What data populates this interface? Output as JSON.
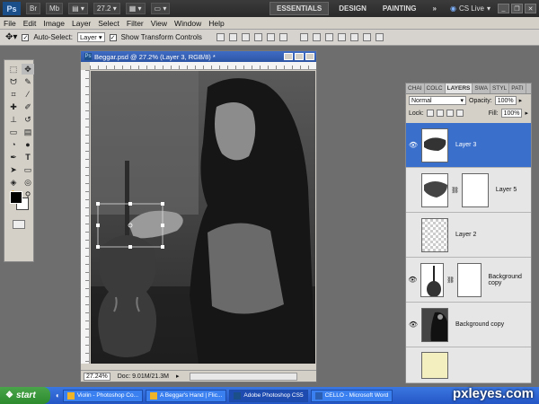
{
  "app": {
    "logo": "Ps",
    "zoom_value": "27.2",
    "workspaces": [
      "ESSENTIALS",
      "DESIGN",
      "PAINTING"
    ],
    "more": "»",
    "cs_live": "CS Live"
  },
  "menu": [
    "File",
    "Edit",
    "Image",
    "Layer",
    "Select",
    "Filter",
    "View",
    "Window",
    "Help"
  ],
  "options": {
    "auto_select_label": "Auto-Select:",
    "auto_select_value": "Layer",
    "show_transform_label": "Show Transform Controls"
  },
  "document": {
    "title": "Beggar.psd @ 27.2% (Layer 3, RGB/8) *",
    "zoom": "27.24%",
    "doc_size": "Doc: 9.01M/21.3M"
  },
  "layers_panel": {
    "tabs": [
      "CHAI",
      "COLC",
      "LAYERS",
      "SWA",
      "STYL",
      "PATI"
    ],
    "blend_mode": "Normal",
    "opacity_label": "Opacity:",
    "opacity_value": "100%",
    "lock_label": "Lock:",
    "fill_label": "Fill:",
    "fill_value": "100%",
    "layers": [
      {
        "name": "Layer 3",
        "selected": true
      },
      {
        "name": "Layer 5",
        "selected": false
      },
      {
        "name": "Layer 2",
        "selected": false
      },
      {
        "name": "Background copy",
        "selected": false
      },
      {
        "name": "Background copy",
        "selected": false
      }
    ]
  },
  "taskbar": {
    "start_label": "start",
    "tasks": [
      "Violin - Photoshop Co...",
      "A Beggar's Hand | Flic...",
      "Adobe Photoshop CS5",
      "CELLO - Microsoft Word"
    ]
  },
  "watermark": "pxleyes.com",
  "colors": {
    "selected_layer": "#3a6fcb",
    "title_bar": "#2d55a5",
    "taskbar": "#2456c6",
    "foreground": "#000000",
    "background": "#ffffff"
  }
}
